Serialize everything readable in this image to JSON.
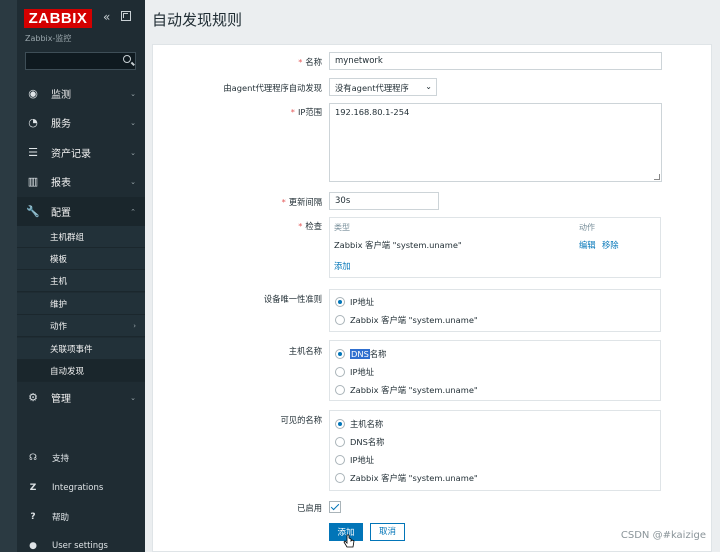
{
  "app": {
    "logo": "ZABBIX",
    "server_name": "Zabbix-监控",
    "page_title": "自动发现规则"
  },
  "sidebar": {
    "menu": [
      {
        "label": "监测",
        "icon": "eye-icon"
      },
      {
        "label": "服务",
        "icon": "clock-icon"
      },
      {
        "label": "资产记录",
        "icon": "list-icon"
      },
      {
        "label": "报表",
        "icon": "bar-chart-icon"
      },
      {
        "label": "配置",
        "icon": "wrench-icon"
      }
    ],
    "sub_items": [
      "主机群组",
      "模板",
      "主机",
      "维护",
      "动作",
      "关联项事件",
      "自动发现"
    ],
    "admin": {
      "label": "管理",
      "icon": "gear-icon"
    },
    "bottom": [
      {
        "label": "支持",
        "icon": "headset-icon"
      },
      {
        "label": "Integrations",
        "icon": "zabbix-z-icon"
      },
      {
        "label": "帮助",
        "icon": "help-icon"
      },
      {
        "label": "User settings",
        "icon": "user-icon"
      }
    ]
  },
  "form": {
    "name_label": "名称",
    "name_value": "mynetwork",
    "proxy_label": "由agent代理程序自动发现",
    "proxy_value": "没有agent代理程序",
    "ip_label": "IP范围",
    "ip_value": "192.168.80.1-254",
    "interval_label": "更新间隔",
    "interval_value": "30s",
    "checks_label": "检查",
    "checks": {
      "col_type": "类型",
      "col_action": "动作",
      "row_type": "Zabbix 客户端 \"system.uname\"",
      "edit": "编辑",
      "remove": "移除",
      "add": "添加"
    },
    "uniqueness_label": "设备唯一性准则",
    "uniqueness_options": [
      "IP地址",
      "Zabbix 客户端 \"system.uname\""
    ],
    "hostname_label": "主机名称",
    "hostname_options": {
      "dns_hl": "DNS",
      "dns_rest": "名称",
      "ip": "IP地址",
      "agent": "Zabbix 客户端 \"system.uname\""
    },
    "visible_label": "可见的名称",
    "visible_options": [
      "主机名称",
      "DNS名称",
      "IP地址",
      "Zabbix 客户端 \"system.uname\""
    ],
    "enabled_label": "已启用",
    "add_button": "添加",
    "cancel_button": "取消"
  },
  "watermark": "CSDN @#kaizige",
  "colors": {
    "brand_red": "#d40000",
    "sidebar_bg": "#1f2c33",
    "accent_blue": "#0275b8"
  }
}
